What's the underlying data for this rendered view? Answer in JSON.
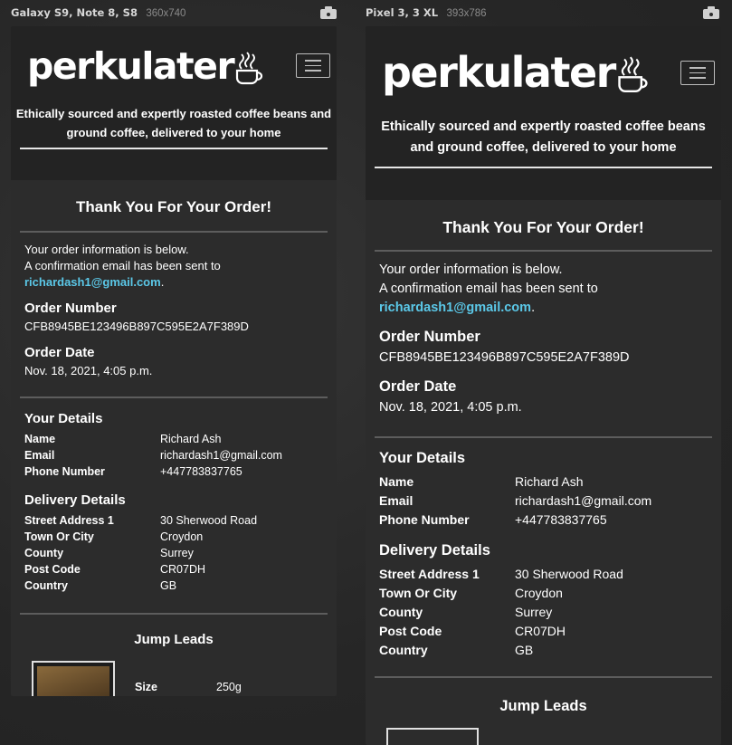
{
  "devices": [
    {
      "name": "Galaxy S9, Note 8, S8",
      "size": "360x740"
    },
    {
      "name": "Pixel 3, 3 XL",
      "size": "393x786"
    }
  ],
  "site": {
    "logo": "perkulater",
    "tagline": "Ethically sourced and expertly roasted coffee beans and ground coffee, delivered to your home",
    "tagline_lines_small": [
      "Ethically sourced and expertly roasted coffee beans and",
      "ground coffee, delivered to your home"
    ],
    "tagline_lines_large": [
      "Ethically sourced and expertly roasted coffee beans",
      "and ground coffee, delivered to your home"
    ]
  },
  "order": {
    "heading": "Thank You For Your Order!",
    "intro_1": "Your order information is below.",
    "intro_2": "A confirmation email has been sent to",
    "email": "richardash1@gmail.com",
    "period": ".",
    "order_number_label": "Order Number",
    "order_number": "CFB8945BE123496B897C595E2A7F389D",
    "order_date_label": "Order Date",
    "order_date": "Nov. 18, 2021, 4:05 p.m."
  },
  "your_details": {
    "heading": "Your Details",
    "rows": [
      {
        "label": "Name",
        "value": "Richard Ash"
      },
      {
        "label": "Email",
        "value": "richardash1@gmail.com"
      },
      {
        "label": "Phone Number",
        "value": "+447783837765"
      }
    ]
  },
  "delivery": {
    "heading": "Delivery Details",
    "rows": [
      {
        "label": "Street Address 1",
        "value": "30 Sherwood Road"
      },
      {
        "label": "Town Or City",
        "value": "Croydon"
      },
      {
        "label": "County",
        "value": "Surrey"
      },
      {
        "label": "Post Code",
        "value": "CR07DH"
      },
      {
        "label": "Country",
        "value": "GB"
      }
    ]
  },
  "item": {
    "name": "Jump Leads",
    "size_label": "Size",
    "size_value": "250g"
  },
  "colors": {
    "accent": "#5bc8e8",
    "header_bg": "#232323",
    "page_bg": "#2c2c2c"
  }
}
